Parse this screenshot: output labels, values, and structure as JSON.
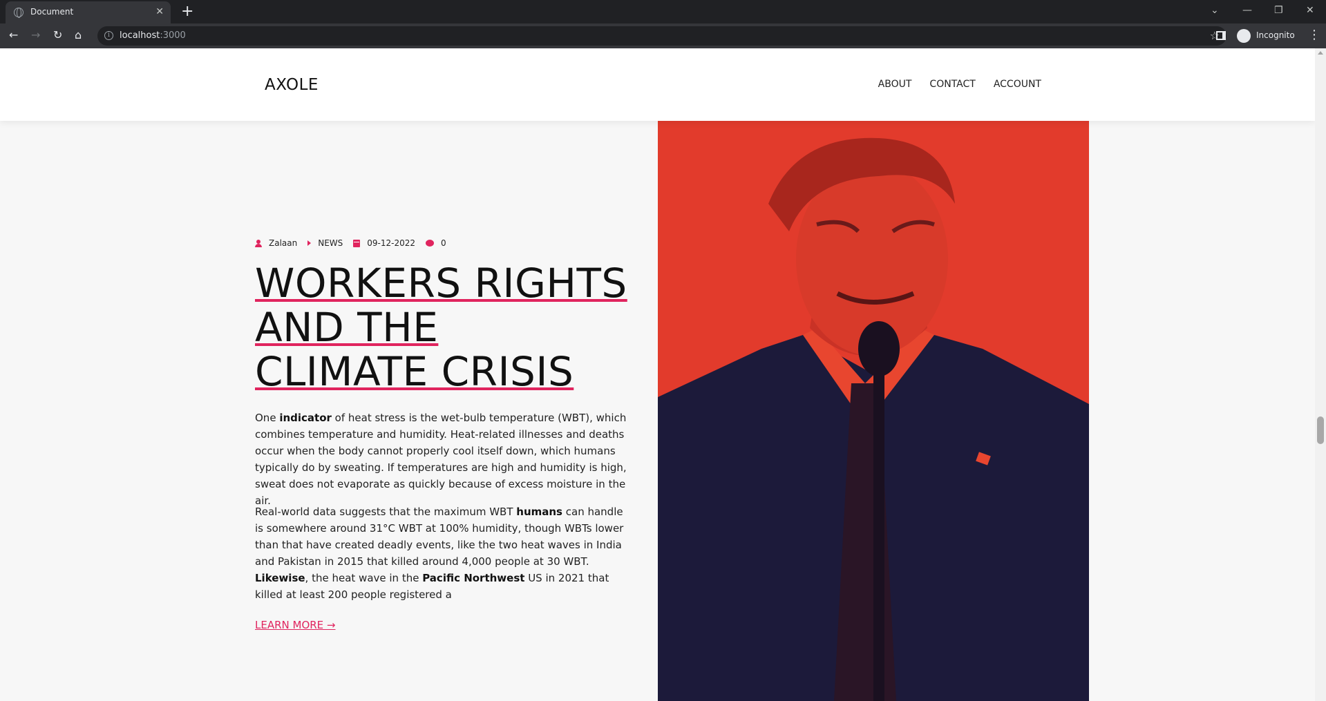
{
  "browser": {
    "tab_title": "Document",
    "url_host": "localhost",
    "url_port": ":3000",
    "profile_label": "Incognito"
  },
  "site": {
    "logo": "AXOLE",
    "nav": [
      "ABOUT",
      "CONTACT",
      "ACCOUNT"
    ]
  },
  "article": {
    "author": "Zalaan",
    "category": "NEWS",
    "date": "09-12-2022",
    "comments": "0",
    "title_lines": [
      "WORKERS RIGHTS",
      "AND THE",
      "CLIMATE CRISIS"
    ],
    "p1": {
      "a": "One ",
      "b": "indicator",
      "c": " of heat stress is the wet-bulb temperature (WBT), which combines temperature and humidity. Heat-related illnesses and deaths occur when the body cannot properly cool itself down, which humans typically do by sweating. If temperatures are high and humidity is high, sweat does not evaporate as quickly because of excess moisture in the air."
    },
    "p2": {
      "a": "Real-world data suggests that the maximum WBT ",
      "b": "humans",
      "c": " can handle is somewhere around 31°C WBT at 100% humidity, though WBTs lower than that have created deadly events, like the two heat waves in India and Pakistan in 2015 that killed around 4,000 people at 30 WBT. ",
      "d": "Likewise",
      "e": ", the heat wave in the ",
      "f": "Pacific Northwest",
      "g": " US in 2021 that killed at least 200 people registered a"
    },
    "learn_more": "LEARN MORE →"
  },
  "colors": {
    "accent": "#e0245e",
    "hero_red": "#e23b2c",
    "hero_navy": "#1c1a3a"
  }
}
